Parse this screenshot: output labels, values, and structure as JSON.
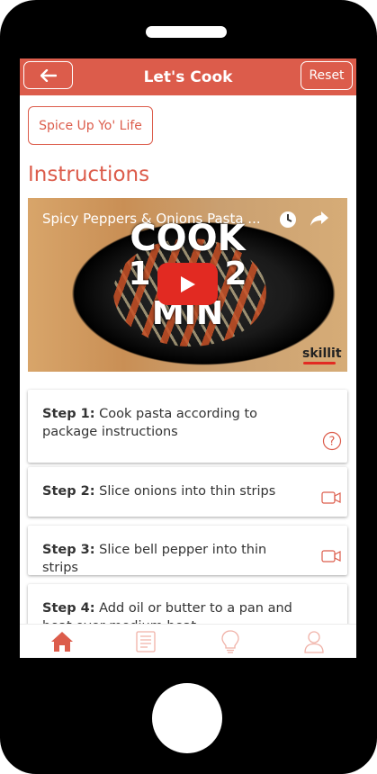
{
  "header": {
    "title": "Let's Cook",
    "reset_label": "Reset"
  },
  "spice_button": "Spice Up Yo' Life",
  "section_title": "Instructions",
  "video": {
    "title": "Spicy Peppers & Onions Pasta ...",
    "overlay_line1": "COOK",
    "overlay_line2": "1",
    "overlay_line2b": "2",
    "overlay_line3": "MIN",
    "brand": "skillit"
  },
  "steps": [
    {
      "label": "Step 1:",
      "text": "Cook pasta according to package instructions",
      "icon": "question-icon"
    },
    {
      "label": "Step 2:",
      "text": "Slice onions into thin strips",
      "icon": "video-icon"
    },
    {
      "label": "Step 3:",
      "text": "Slice bell pepper into thin strips",
      "icon": "video-icon"
    },
    {
      "label": "Step 4:",
      "text": "Add oil or butter to a pan and heat over medium heat",
      "icon": "video-icon"
    }
  ],
  "nav": [
    "home-icon",
    "recipe-list-icon",
    "lightbulb-icon",
    "profile-icon"
  ],
  "colors": {
    "accent": "#dc5c4b",
    "active_nav": "#dc5c4b",
    "inactive_nav": "#f0b2a8",
    "video_play": "#e22a22"
  }
}
